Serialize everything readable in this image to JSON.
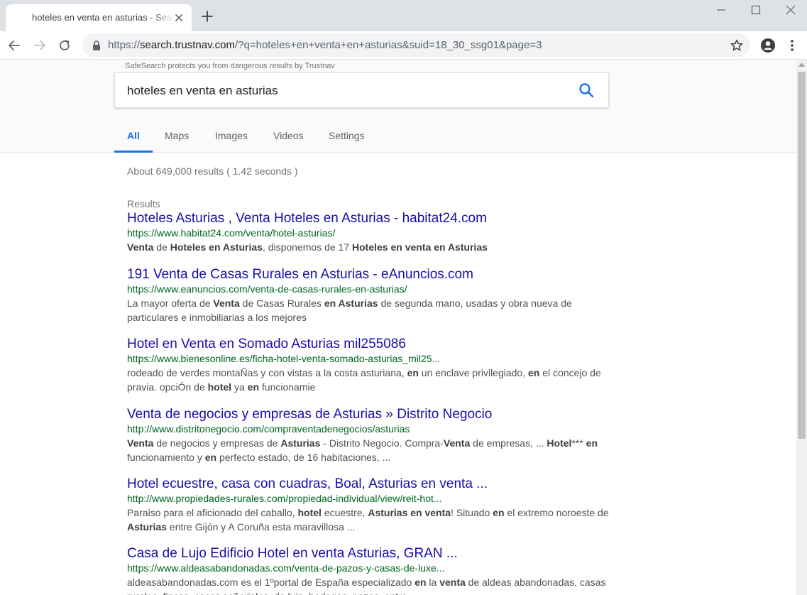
{
  "browser": {
    "tab_title": "hoteles en venta en asturias - Search",
    "url_scheme": "https://",
    "url_host": "search.trustnav.com",
    "url_path": "/?q=hoteles+en+venta+en+asturias&suid=18_30_ssg01&page=3"
  },
  "search": {
    "safesearch_note": "SafeSearch protects you from dangerous results by Trustnav",
    "query": "hoteles en venta en asturias"
  },
  "tabs": [
    {
      "label": "All",
      "active": true
    },
    {
      "label": "Maps",
      "active": false
    },
    {
      "label": "Images",
      "active": false
    },
    {
      "label": "Videos",
      "active": false
    },
    {
      "label": "Settings",
      "active": false
    }
  ],
  "stats": "About 649,000 results ( 1.42 seconds )",
  "results_heading": "Results",
  "results": [
    {
      "title": "Hoteles Asturias , Venta Hoteles en Asturias - habitat24.com",
      "url": "https://www.habitat24.com/venta/hotel-asturias/",
      "snippet": [
        {
          "t": "Venta",
          "b": true
        },
        {
          "t": " de ",
          "b": false
        },
        {
          "t": "Hoteles en Asturias",
          "b": true
        },
        {
          "t": ", disponemos de 17 ",
          "b": false
        },
        {
          "t": "Hoteles en venta en Asturias",
          "b": true
        }
      ]
    },
    {
      "title": "191 Venta de Casas Rurales en Asturias - eAnuncios.com",
      "url": "https://www.eanuncios.com/venta-de-casas-rurales-en-asturias/",
      "snippet": [
        {
          "t": "La mayor oferta de ",
          "b": false
        },
        {
          "t": "Venta",
          "b": true
        },
        {
          "t": " de Casas Rurales ",
          "b": false
        },
        {
          "t": "en Asturias",
          "b": true
        },
        {
          "t": " de segunda mano, usadas y obra nueva de particulares e inmobiliarias a los mejores",
          "b": false
        }
      ]
    },
    {
      "title": "Hotel en Venta en Somado Asturias mil255086",
      "url": "https://www.bienesonline.es/ficha-hotel-venta-somado-asturias_mil25...",
      "snippet": [
        {
          "t": "rodeado de verdes montaÑas y con vistas a la costa asturiana, ",
          "b": false
        },
        {
          "t": "en",
          "b": true
        },
        {
          "t": " un enclave privilegiado, ",
          "b": false
        },
        {
          "t": "en",
          "b": true
        },
        {
          "t": " el concejo de pravia. opciÓn de ",
          "b": false
        },
        {
          "t": "hotel",
          "b": true
        },
        {
          "t": " ya ",
          "b": false
        },
        {
          "t": "en",
          "b": true
        },
        {
          "t": " funcionamie",
          "b": false
        }
      ]
    },
    {
      "title": "Venta de negocios y empresas de Asturias » Distrito Negocio",
      "url": "http://www.distritonegocio.com/compraventadenegocios/asturias",
      "snippet": [
        {
          "t": "Venta",
          "b": true
        },
        {
          "t": " de negocios y empresas de ",
          "b": false
        },
        {
          "t": "Asturias",
          "b": true
        },
        {
          "t": " - Distrito Negocio. Compra-",
          "b": false
        },
        {
          "t": "Venta",
          "b": true
        },
        {
          "t": " de empresas, ... ",
          "b": false
        },
        {
          "t": "Hotel",
          "b": true
        },
        {
          "t": "*** ",
          "b": false
        },
        {
          "t": "en",
          "b": true
        },
        {
          "t": " funcionamiento y ",
          "b": false
        },
        {
          "t": "en",
          "b": true
        },
        {
          "t": " perfecto estado, de 16 habitaciones, ...",
          "b": false
        }
      ]
    },
    {
      "title": "Hotel ecuestre, casa con cuadras, Boal, Asturias en venta ...",
      "url": "http://www.propiedades-rurales.com/propiedad-individual/view/reit-hot...",
      "snippet": [
        {
          "t": "Paraiso para el aficionado del caballo, ",
          "b": false
        },
        {
          "t": "hotel",
          "b": true
        },
        {
          "t": " ecuestre, ",
          "b": false
        },
        {
          "t": "Asturias en venta",
          "b": true
        },
        {
          "t": "! Situado ",
          "b": false
        },
        {
          "t": "en",
          "b": true
        },
        {
          "t": " el extremo noroeste de ",
          "b": false
        },
        {
          "t": "Asturias",
          "b": true
        },
        {
          "t": " entre Gijón y A Coruña esta maravillosa ...",
          "b": false
        }
      ]
    },
    {
      "title": "Casa de Lujo Edificio Hotel en venta Asturias, GRAN ...",
      "url": "https://www.aldeasabandonadas.com/venta-de-pazos-y-casas-de-luxe...",
      "snippet": [
        {
          "t": "aldeasabandonadas.com es el 1ºportal de España especializado ",
          "b": false
        },
        {
          "t": "en",
          "b": true
        },
        {
          "t": " la ",
          "b": false
        },
        {
          "t": "venta",
          "b": true
        },
        {
          "t": " de aldeas abandonadas, casas rurales, fincas, casas señoriales, de lujo, bodegas, pazos, entre...",
          "b": false
        }
      ]
    }
  ],
  "colors": {
    "link": "#1a0dab",
    "url_green": "#006621",
    "accent": "#1a73e8",
    "tabstrip": "#dee1e6"
  }
}
